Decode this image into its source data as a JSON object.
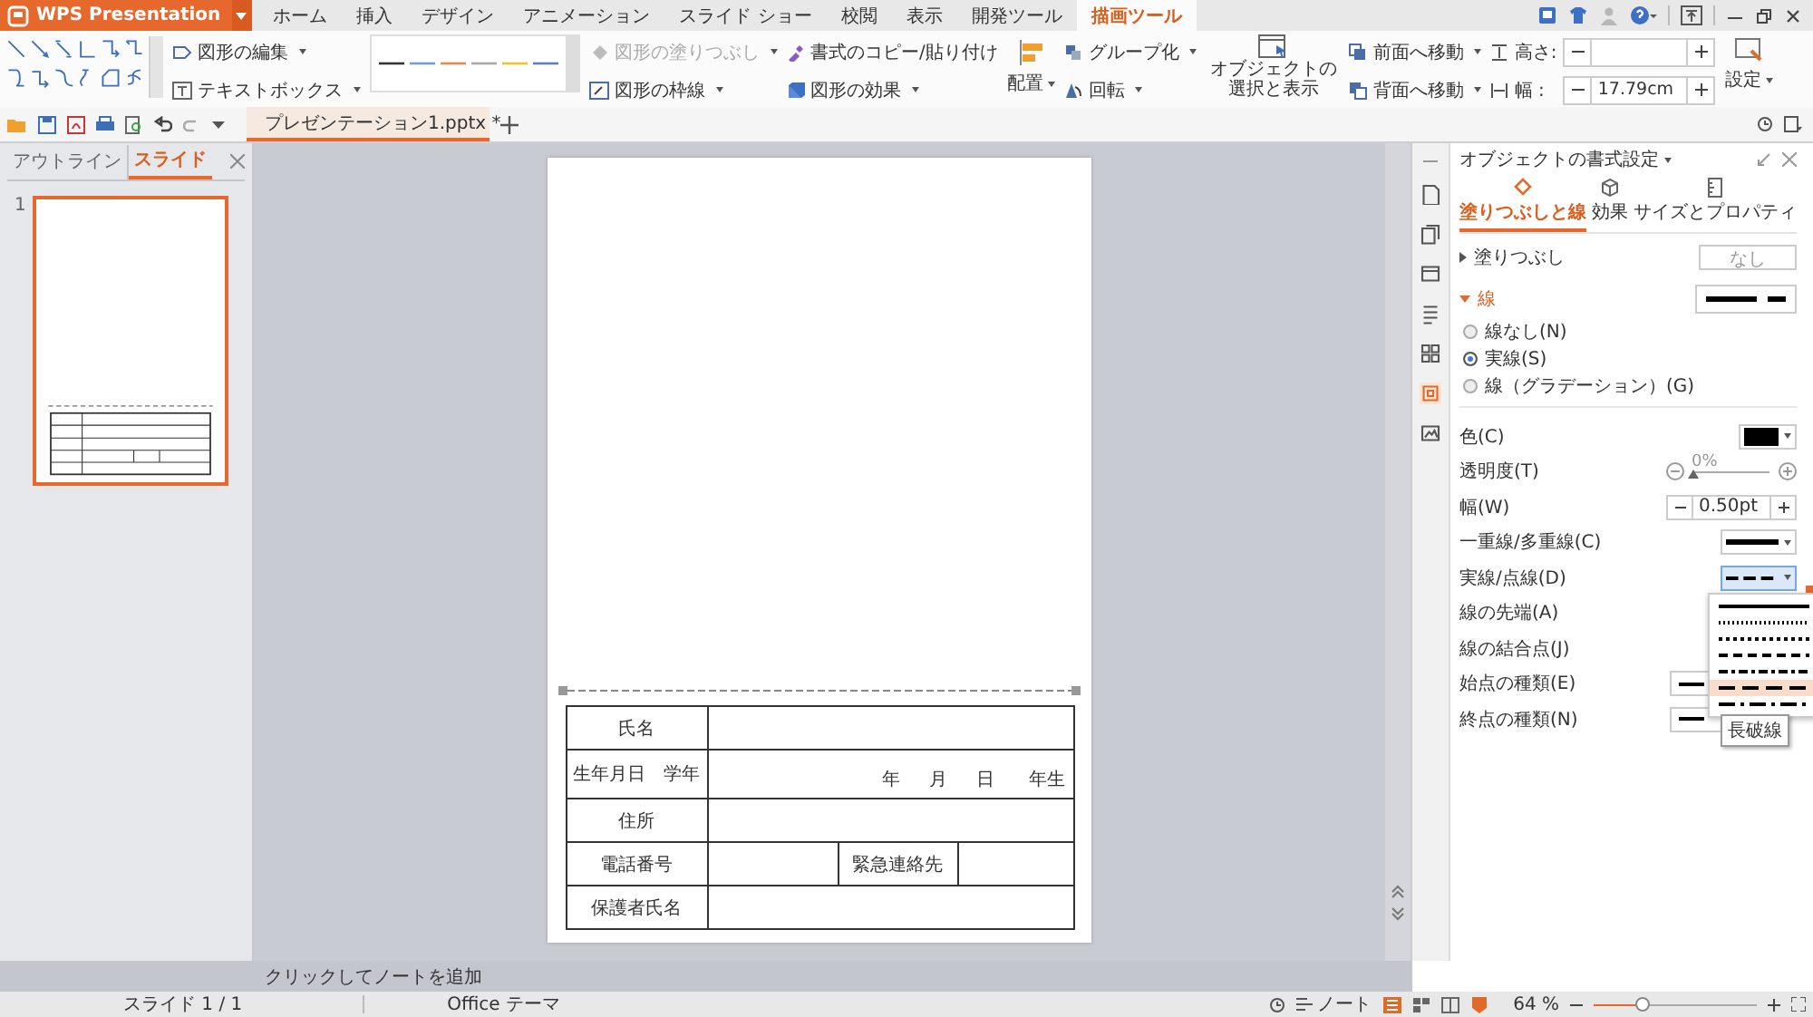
{
  "app": {
    "name": "WPS Presentation"
  },
  "tabs": [
    {
      "label": "ホーム",
      "selected": false
    },
    {
      "label": "挿入",
      "selected": false
    },
    {
      "label": "デザイン",
      "selected": false
    },
    {
      "label": "アニメーション",
      "selected": false
    },
    {
      "label": "スライド ショー",
      "selected": false
    },
    {
      "label": "校閲",
      "selected": false
    },
    {
      "label": "表示",
      "selected": false
    },
    {
      "label": "開発ツール",
      "selected": false
    },
    {
      "label": "描画ツール",
      "selected": true
    }
  ],
  "ribbon": {
    "edit_shape": "図形の編集",
    "text_box": "テキストボックス",
    "line_styles": [
      {
        "color": "#333333"
      },
      {
        "color": "#6e9fd6"
      },
      {
        "color": "#e58a4e"
      },
      {
        "color": "#a9a9a9"
      },
      {
        "color": "#f0c330"
      },
      {
        "color": "#5b7fc4"
      }
    ],
    "fill": {
      "label": "図形の塗りつぶし",
      "disabled": true
    },
    "outline": "図形の枠線",
    "format_painter": "書式のコピー/貼り付け",
    "effects": "図形の効果",
    "align": "配置",
    "group": "グループ化",
    "rotate": "回転",
    "selection_pane": "オブジェクトの選択と表示",
    "bring_forward": "前面へ移動",
    "send_backward": "背面へ移動",
    "height": {
      "label": "高さ:"
    },
    "width": {
      "label": "幅 :",
      "value": "17.79cm"
    },
    "settings": "設定"
  },
  "document_tab": {
    "title": "プレゼンテーション1.pptx *"
  },
  "left_panel": {
    "tabs": [
      {
        "label": "アウトライン",
        "selected": false
      },
      {
        "label": "スライド",
        "selected": true
      }
    ],
    "slides": [
      {
        "number": "1",
        "selected": true
      }
    ]
  },
  "slide": {
    "table": {
      "rows": [
        {
          "kind": "plain",
          "label": "氏名"
        },
        {
          "kind": "date",
          "label": "生年月日　学年",
          "parts": [
            "年",
            "月",
            "日",
            "年生"
          ]
        },
        {
          "kind": "plain",
          "label": "住所"
        },
        {
          "kind": "split",
          "label": "電話番号",
          "second_label": "緊急連絡先"
        },
        {
          "kind": "plain",
          "label": "保護者氏名"
        }
      ]
    }
  },
  "notes": {
    "placeholder": "クリックしてノートを追加"
  },
  "side_buttons": [
    {
      "selected": false
    },
    {
      "selected": false
    },
    {
      "selected": false
    },
    {
      "selected": false
    },
    {
      "selected": false
    },
    {
      "selected": true
    },
    {
      "selected": false
    }
  ],
  "format_panel": {
    "title": "オブジェクトの書式設定",
    "tabs": [
      {
        "label": "塗りつぶしと線",
        "selected": true
      },
      {
        "label": "効果",
        "selected": false
      },
      {
        "label": "サイズとプロパティ",
        "selected": false
      }
    ],
    "fill": {
      "label": "塗りつぶし",
      "expanded": false,
      "value": "なし"
    },
    "line": {
      "label": "線",
      "expanded": true
    },
    "line_types": [
      {
        "label": "線なし(N)",
        "selected": false
      },
      {
        "label": "実線(S)",
        "selected": true
      },
      {
        "label": "線（グラデーション）(G)",
        "selected": false
      }
    ],
    "properties": [
      {
        "kind": "color",
        "label": "色(C)",
        "color": "#000000"
      },
      {
        "kind": "slider",
        "label": "透明度(T)",
        "level": 0,
        "reading": "0%"
      },
      {
        "kind": "spin",
        "label": "幅(W)",
        "value": "0.50pt"
      },
      {
        "kind": "compound",
        "label": "一重線/多重線(C)"
      },
      {
        "kind": "dash",
        "label": "実線/点線(D)",
        "expanded": true
      },
      {
        "kind": "blank",
        "label": "線の先端(A)"
      },
      {
        "kind": "blank",
        "label": "線の結合点(J)"
      },
      {
        "kind": "arrow",
        "label": "始点の種類(E)"
      },
      {
        "kind": "arrow",
        "label": "終点の種類(N)"
      }
    ],
    "dash_menu": {
      "options": [
        {
          "kind": "solid",
          "selected": false
        },
        {
          "kind": "round-dot",
          "selected": false
        },
        {
          "kind": "square-dot",
          "selected": false
        },
        {
          "kind": "dash",
          "selected": false
        },
        {
          "kind": "dash-dot",
          "selected": false
        },
        {
          "kind": "long-dash",
          "selected": true
        },
        {
          "kind": "long-dash-dot",
          "selected": false
        }
      ],
      "tooltip": "長破線"
    }
  },
  "status_bar": {
    "slide": "スライド 1 / 1",
    "theme": "Office テーマ",
    "notes": "ノート",
    "zoom": "64 %",
    "zoom_slider": {
      "level": 0.3
    }
  }
}
